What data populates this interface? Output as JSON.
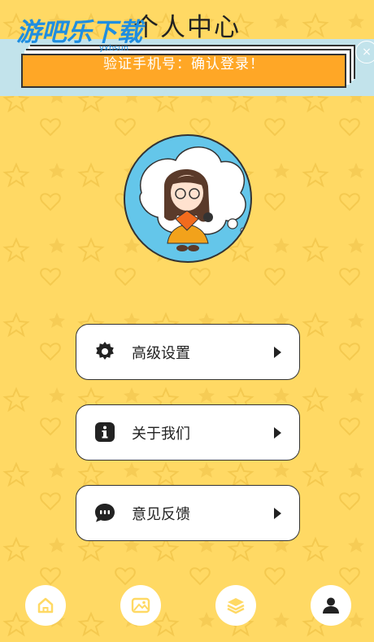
{
  "header": {
    "title": "个人中心"
  },
  "watermark": {
    "text": "游吧乐下载",
    "sub": "yxbsun"
  },
  "banner": {
    "text": "验证手机号：确认登录！",
    "close": "×",
    "colors": {
      "card": "#ffa726",
      "strip": "#bfe4f2"
    }
  },
  "profile": {
    "avatar_alt": "cartoon-girl-avatar"
  },
  "menu": {
    "items": [
      {
        "label": "高级设置",
        "icon": "gear-icon"
      },
      {
        "label": "关于我们",
        "icon": "info-icon"
      },
      {
        "label": "意见反馈",
        "icon": "chat-bubble-icon"
      }
    ]
  },
  "bottom_nav": {
    "items": [
      {
        "icon": "home-icon",
        "active": false
      },
      {
        "icon": "image-icon",
        "active": false
      },
      {
        "icon": "layers-icon",
        "active": false
      },
      {
        "icon": "user-icon",
        "active": true
      }
    ]
  },
  "colors": {
    "background": "#ffd964",
    "active_icon": "#222222",
    "inactive_icon": "#ffd964"
  }
}
